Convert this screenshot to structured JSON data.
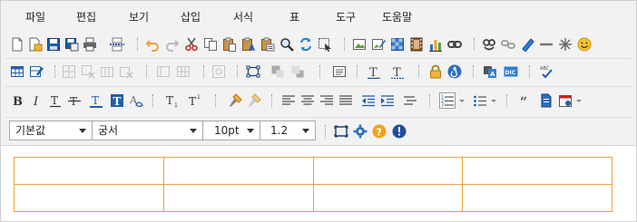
{
  "menu": {
    "items": [
      "파일",
      "편집",
      "보기",
      "삽입",
      "서식",
      "표",
      "도구",
      "도움말"
    ]
  },
  "toolbar": {
    "style_select": {
      "value": "기본값"
    },
    "font_select": {
      "value": "궁서"
    },
    "size_select": {
      "value": "10pt"
    },
    "line_height_select": {
      "value": "1.2"
    }
  },
  "icons": {
    "row1": [
      "new-document-icon",
      "open-template-icon",
      "save-icon",
      "save-as-icon",
      "print-icon",
      "page-break-icon",
      "undo-icon",
      "redo-icon",
      "cut-icon",
      "copy-icon",
      "paste-icon",
      "paste-text-icon",
      "paste-word-icon",
      "find-icon",
      "replace-icon",
      "select-all-icon",
      "image-icon",
      "edit-image-icon",
      "pattern-icon",
      "video-icon",
      "chart-icon",
      "link-icon",
      "anchor-icon",
      "unlink-icon",
      "bookmark-icon",
      "horizontal-rule-icon",
      "special-char-icon",
      "emoticon-icon"
    ],
    "row2": [
      "table-icon",
      "table-edit-icon",
      "merge-cells-icon",
      "delete-cells-icon",
      "insert-row-icon",
      "delete-row-icon",
      "table-layout-icon",
      "table-grid-icon",
      "cell-props-icon",
      "box-icon",
      "bring-front-icon",
      "send-back-icon",
      "text-box-icon",
      "text-style-icon",
      "text-style2-icon",
      "lock-icon",
      "accessibility-icon",
      "translate-icon",
      "dictionary-icon",
      "spellcheck-icon"
    ],
    "row3": [
      "bold-icon",
      "italic-icon",
      "underline-icon",
      "strikethrough-icon",
      "text-underline-icon",
      "text-highlight-icon",
      "clear-format-icon",
      "subscript-icon",
      "superscript-icon",
      "format-painter-icon",
      "clear-painter-icon",
      "align-left-icon",
      "align-center-icon",
      "align-right-icon",
      "justify-icon",
      "outdent-icon",
      "indent-icon",
      "line-spacing-icon",
      "numbered-list-icon",
      "bullet-list-icon",
      "quote-icon",
      "document-icon",
      "calendar-icon"
    ],
    "row4": [
      "fullscreen-icon",
      "settings-icon",
      "help-icon",
      "info-icon"
    ]
  },
  "colors": {
    "toolbar_bg": "#f2f2f2",
    "table_border": "#e8a33c",
    "accent_blue": "#1a5fb4",
    "accent_orange": "#e8a33c"
  },
  "document": {
    "table": {
      "rows": 2,
      "cols": 4,
      "cells": [
        [
          "",
          "",
          "",
          ""
        ],
        [
          "",
          "",
          "",
          ""
        ]
      ]
    }
  }
}
